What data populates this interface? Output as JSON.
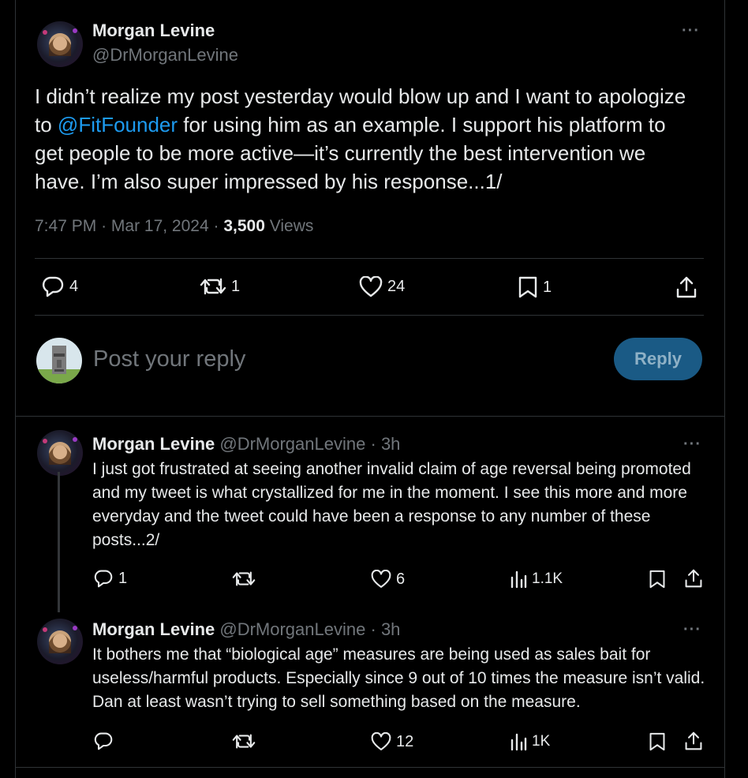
{
  "main_post": {
    "author_name": "Morgan Levine",
    "author_handle": "@DrMorganLevine",
    "text_before": "I didn’t realize my post yesterday would blow up and I want to apologize to ",
    "mention": "@FitFounder",
    "text_after": " for using him as an example. I support his platform to get people to be more active—it’s currently the best intervention we have. I’m also super impressed by his response...1/",
    "time": "7:47 PM",
    "date": "Mar 17, 2024",
    "views_count": "3,500",
    "views_label": "Views",
    "sep": "·",
    "stats": {
      "replies": "4",
      "reposts": "1",
      "likes": "24",
      "bookmarks": "1"
    },
    "more": "···"
  },
  "composer": {
    "placeholder": "Post your reply",
    "button_label": "Reply"
  },
  "replies": [
    {
      "author_name": "Morgan Levine",
      "author_handle": "@DrMorganLevine",
      "sep": "·",
      "time": "3h",
      "text": "I just got frustrated at seeing another invalid claim of age reversal being promoted and my tweet is what crystallized for me in the moment. I see this more and more everyday and the tweet could have been a response to any number of these posts...2/",
      "stats": {
        "replies": "1",
        "reposts": "",
        "likes": "6",
        "views": "1.1K"
      },
      "more": "···"
    },
    {
      "author_name": "Morgan Levine",
      "author_handle": "@DrMorganLevine",
      "sep": "·",
      "time": "3h",
      "text": "It bothers me that “biological age” measures are being used as sales bait for useless/harmful products. Especially since 9 out of 10 times the measure isn’t valid. Dan at least wasn’t trying to sell something based on the measure.",
      "stats": {
        "replies": "",
        "reposts": "",
        "likes": "12",
        "views": "1K"
      },
      "more": "···"
    }
  ],
  "colors": {
    "accent": "#1d9bf0",
    "muted": "#71767b",
    "text": "#e7e9ea",
    "border": "#2f3336",
    "reply_button": "#1a5a85"
  }
}
